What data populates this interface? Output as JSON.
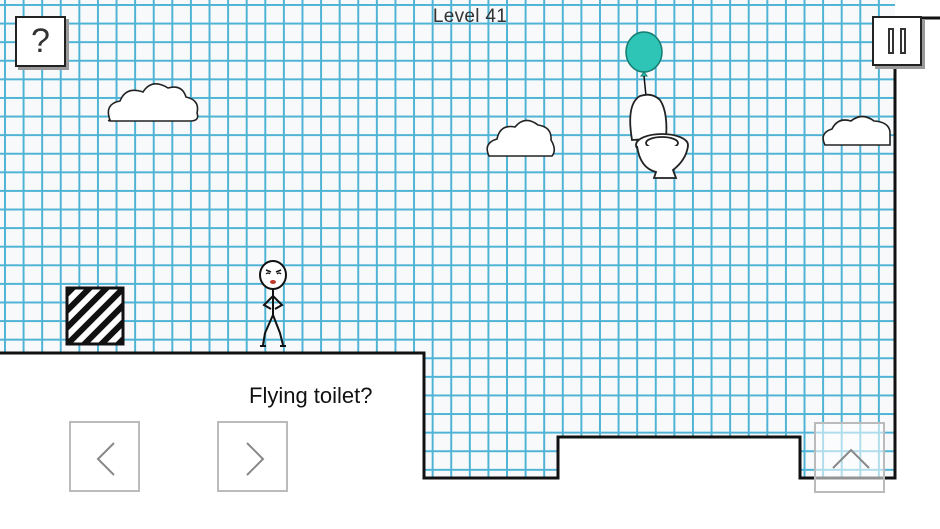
{
  "header": {
    "level_label": "Level 41"
  },
  "buttons": {
    "help_label": "?",
    "pause_icon": "pause-icon",
    "left_icon": "chevron-left-icon",
    "right_icon": "chevron-right-icon",
    "jump_icon": "chevron-up-icon"
  },
  "dialog": {
    "text": "Flying toilet?"
  },
  "colors": {
    "grid_line": "#4fb3d6",
    "balloon": "#2ec4b6",
    "ink": "#111111"
  }
}
